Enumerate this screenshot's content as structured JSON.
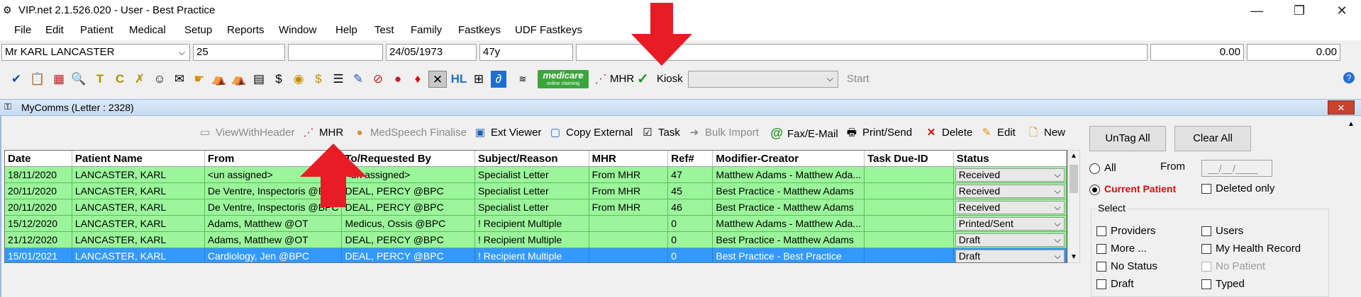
{
  "window": {
    "title": "VIP.net 2.1.526.020 - User - Best Practice",
    "minimize": "—",
    "restore": "❐",
    "close": "✕"
  },
  "menu": [
    "File",
    "Edit",
    "Patient",
    "Medical",
    "Setup",
    "Reports",
    "Window",
    "Help",
    "Test",
    "Family",
    "Fastkeys",
    "UDF Fastkeys"
  ],
  "patient": {
    "name": "Mr KARL LANCASTER",
    "field2": "25",
    "field3": "",
    "dob": "24/05/1973",
    "age": "47y",
    "notes": "",
    "balance1": "0.00",
    "balance2": "0.00"
  },
  "toolbar": {
    "mhr_label": "MHR",
    "medicare_label": "medicare",
    "medicare_sub": "online claiming",
    "kiosk_label": "Kiosk",
    "kiosk_value": "",
    "start_label": "Start"
  },
  "mycomms": {
    "title": "MyComms (Letter : 2328)",
    "close": "✕",
    "tools": [
      {
        "label": "ViewWithHeader",
        "enabled": false
      },
      {
        "label": "MHR",
        "enabled": true
      },
      {
        "label": "MedSpeech Finalise",
        "enabled": false
      },
      {
        "label": "Ext Viewer",
        "enabled": true
      },
      {
        "label": "Copy External",
        "enabled": true
      },
      {
        "label": "Task",
        "enabled": true
      },
      {
        "label": "Bulk Import",
        "enabled": false
      },
      {
        "label": "Fax/E-Mail",
        "enabled": true
      },
      {
        "label": "Print/Send",
        "enabled": true
      },
      {
        "label": "Delete",
        "enabled": true
      },
      {
        "label": "Edit",
        "enabled": true
      },
      {
        "label": "New",
        "enabled": true
      }
    ],
    "columns": [
      "Date",
      "Patient Name",
      "From",
      "To/Requested By",
      "Subject/Reason",
      "MHR",
      "Ref#",
      "Modifier-Creator",
      "Task Due-ID",
      "Status"
    ],
    "rows": [
      [
        "18/11/2020",
        "LANCASTER, KARL",
        "<un assigned>",
        "<un assigned>",
        "Specialist Letter",
        "From MHR",
        "47",
        "Matthew Adams - Matthew Ada...",
        "",
        "Received"
      ],
      [
        "20/11/2020",
        "LANCASTER, KARL",
        "De Ventre, Inspectoris @BPC",
        "DEAL, PERCY @BPC",
        "Specialist Letter",
        "From MHR",
        "45",
        "Best Practice - Matthew Adams",
        "",
        "Received"
      ],
      [
        "20/11/2020",
        "LANCASTER, KARL",
        "De Ventre, Inspectoris @BPC",
        "DEAL, PERCY @BPC",
        "Specialist Letter",
        "From MHR",
        "46",
        "Best Practice - Matthew Adams",
        "",
        "Received"
      ],
      [
        "15/12/2020",
        "LANCASTER, KARL",
        "Adams, Matthew @OT",
        "Medicus, Ossis @BPC",
        "! Recipient Multiple",
        "",
        "0",
        "Matthew Adams - Matthew Ada...",
        "",
        "Printed/Sent"
      ],
      [
        "21/12/2020",
        "LANCASTER, KARL",
        "Adams, Matthew @OT",
        "DEAL, PERCY @BPC",
        "! Recipient Multiple",
        "",
        "0",
        "Best Practice - Matthew Adams",
        "",
        "Draft"
      ],
      [
        "15/01/2021",
        "LANCASTER, KARL",
        "Cardiology, Jen @BPC",
        "DEAL, PERCY @BPC",
        "! Recipient Multiple",
        "",
        "0",
        "Best Practice - Best Practice",
        "",
        "Draft"
      ]
    ],
    "selected_row": 5
  },
  "filters": {
    "untag_all": "UnTag All",
    "clear_all": "Clear All",
    "all_label": "All",
    "from_label": "From",
    "from_value": "__/__/____",
    "current_patient": "Current Patient",
    "deleted_only": "Deleted only",
    "select_label": "Select",
    "left_items": [
      {
        "label": "Providers",
        "enabled": true
      },
      {
        "label": "More ...",
        "enabled": true
      },
      {
        "label": "No Status",
        "enabled": true
      },
      {
        "label": "Draft",
        "enabled": true
      }
    ],
    "right_items": [
      {
        "label": "Users",
        "enabled": true
      },
      {
        "label": "My Health Record",
        "enabled": true
      },
      {
        "label": "No Patient",
        "enabled": false
      },
      {
        "label": "Typed",
        "enabled": true
      }
    ]
  },
  "colors": {
    "row_green": "#9bf59b",
    "row_selected": "#3399ff",
    "arrow_red": "#e81c24",
    "current_patient_red": "#d01010"
  }
}
